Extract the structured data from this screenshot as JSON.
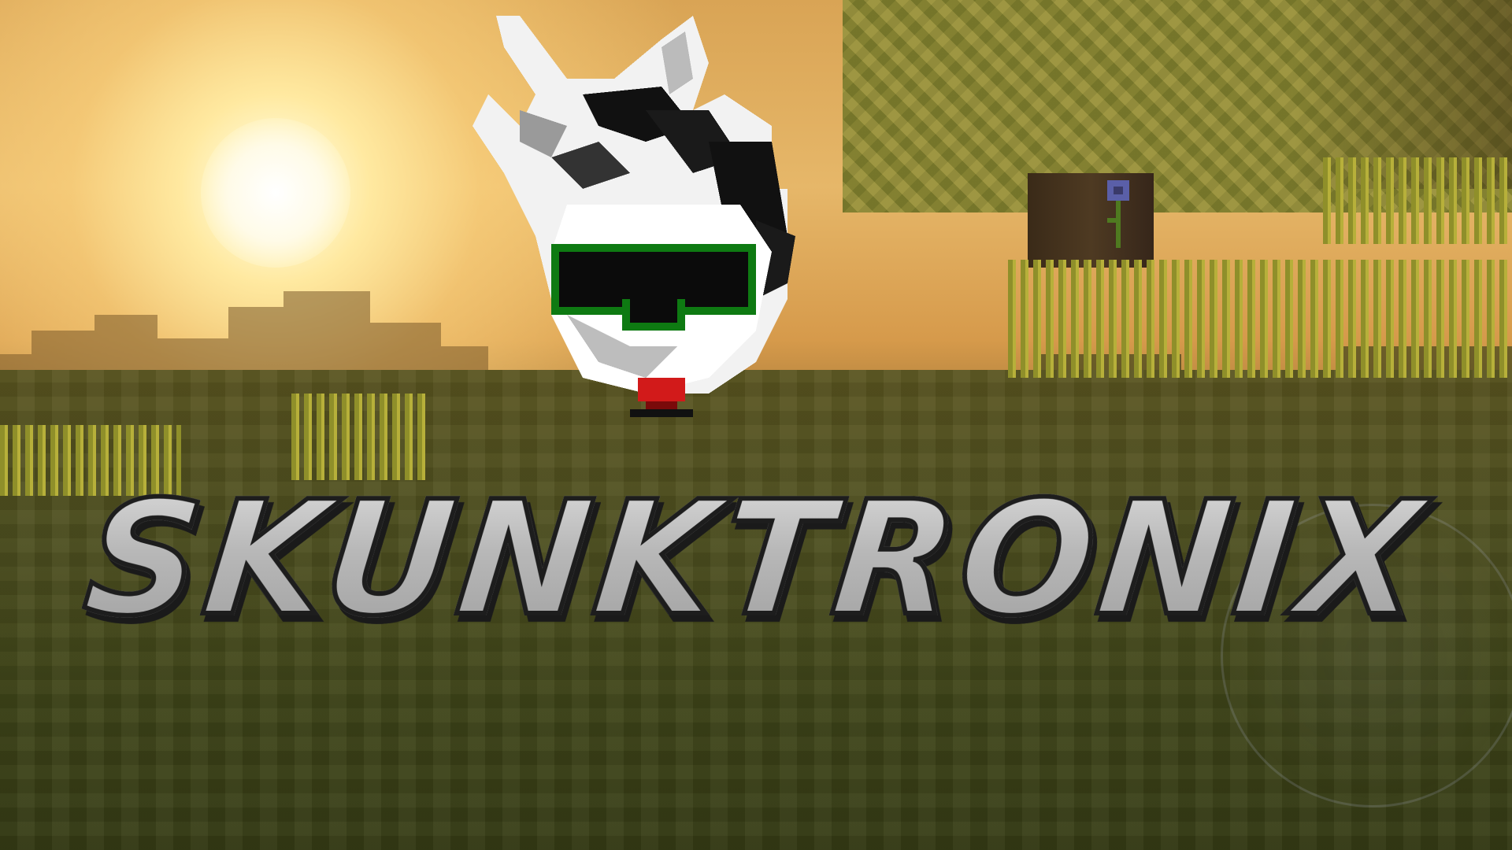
{
  "title": "SKUNKTRONIX",
  "colors": {
    "sun": "#fffdf0",
    "sky": "#e6b769",
    "grass": "#4e5020",
    "title_fill": "#bdbdbd",
    "title_outline": "#1d1d1d",
    "goggles_frame": "#0e7a12",
    "tongue": "#d21a1a"
  },
  "icons": {
    "mascot": "skunk-head-icon"
  }
}
